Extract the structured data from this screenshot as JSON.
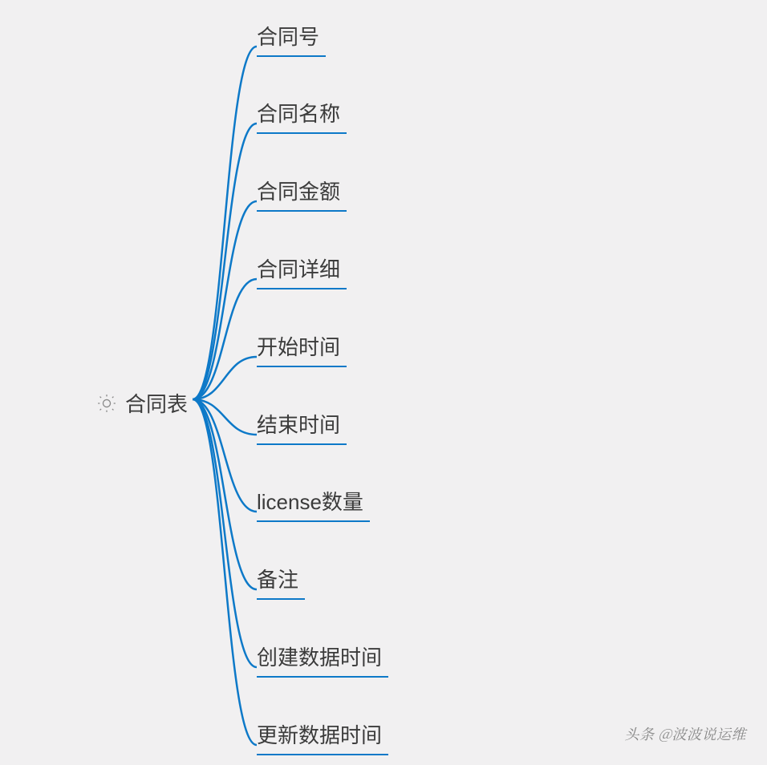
{
  "root": {
    "label": "合同表",
    "icon": "lightbulb-icon"
  },
  "children": [
    {
      "label": "合同号"
    },
    {
      "label": "合同名称"
    },
    {
      "label": "合同金额"
    },
    {
      "label": "合同详细"
    },
    {
      "label": "开始时间"
    },
    {
      "label": "结束时间"
    },
    {
      "label": "license数量"
    },
    {
      "label": "备注"
    },
    {
      "label": "创建数据时间"
    },
    {
      "label": "更新数据时间"
    }
  ],
  "watermark": "头条 @波波说运维",
  "colors": {
    "branch": "#0d79c8",
    "text": "#3b3b3b",
    "bg": "#f1f0f1"
  },
  "chart_data": {
    "type": "mindmap",
    "root": "合同表",
    "branches": [
      "合同号",
      "合同名称",
      "合同金额",
      "合同详细",
      "开始时间",
      "结束时间",
      "license数量",
      "备注",
      "创建数据时间",
      "更新数据时间"
    ]
  }
}
